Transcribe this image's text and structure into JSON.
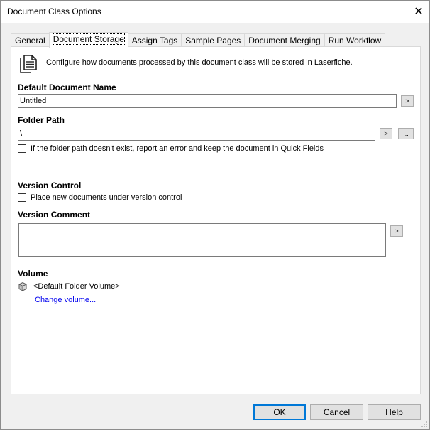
{
  "window": {
    "title": "Document Class Options",
    "close_glyph": "✕"
  },
  "tabs": [
    {
      "label": "General"
    },
    {
      "label": "Document Storage"
    },
    {
      "label": "Assign Tags"
    },
    {
      "label": "Sample Pages"
    },
    {
      "label": "Document Merging"
    },
    {
      "label": "Run Workflow"
    }
  ],
  "active_tab": "Document Storage",
  "panel": {
    "info_icon": "document-icon",
    "info_text": "Configure how documents processed by this document class will be stored in Laserfiche.",
    "default_name": {
      "label": "Default Document Name",
      "value": "Untitled",
      "token_button": ">"
    },
    "folder_path": {
      "label": "Folder Path",
      "value": "\\",
      "token_button": ">",
      "browse_button": "...",
      "error_checkbox_label": "If the folder path doesn't exist, report an error and keep the document in Quick Fields",
      "error_checked": false
    },
    "version_control": {
      "label": "Version Control",
      "checkbox_label": "Place new documents under version control",
      "checked": false
    },
    "version_comment": {
      "label": "Version Comment",
      "value": "",
      "token_button": ">"
    },
    "volume": {
      "label": "Volume",
      "icon": "volume-icon",
      "value": "<Default Folder Volume>",
      "change_link": "Change volume..."
    }
  },
  "footer": {
    "ok_label": "OK",
    "cancel_label": "Cancel",
    "help_label": "Help"
  },
  "colors": {
    "accent": "#0078d7",
    "link": "#0000ee",
    "dialog_bg": "#f0f0f0"
  }
}
